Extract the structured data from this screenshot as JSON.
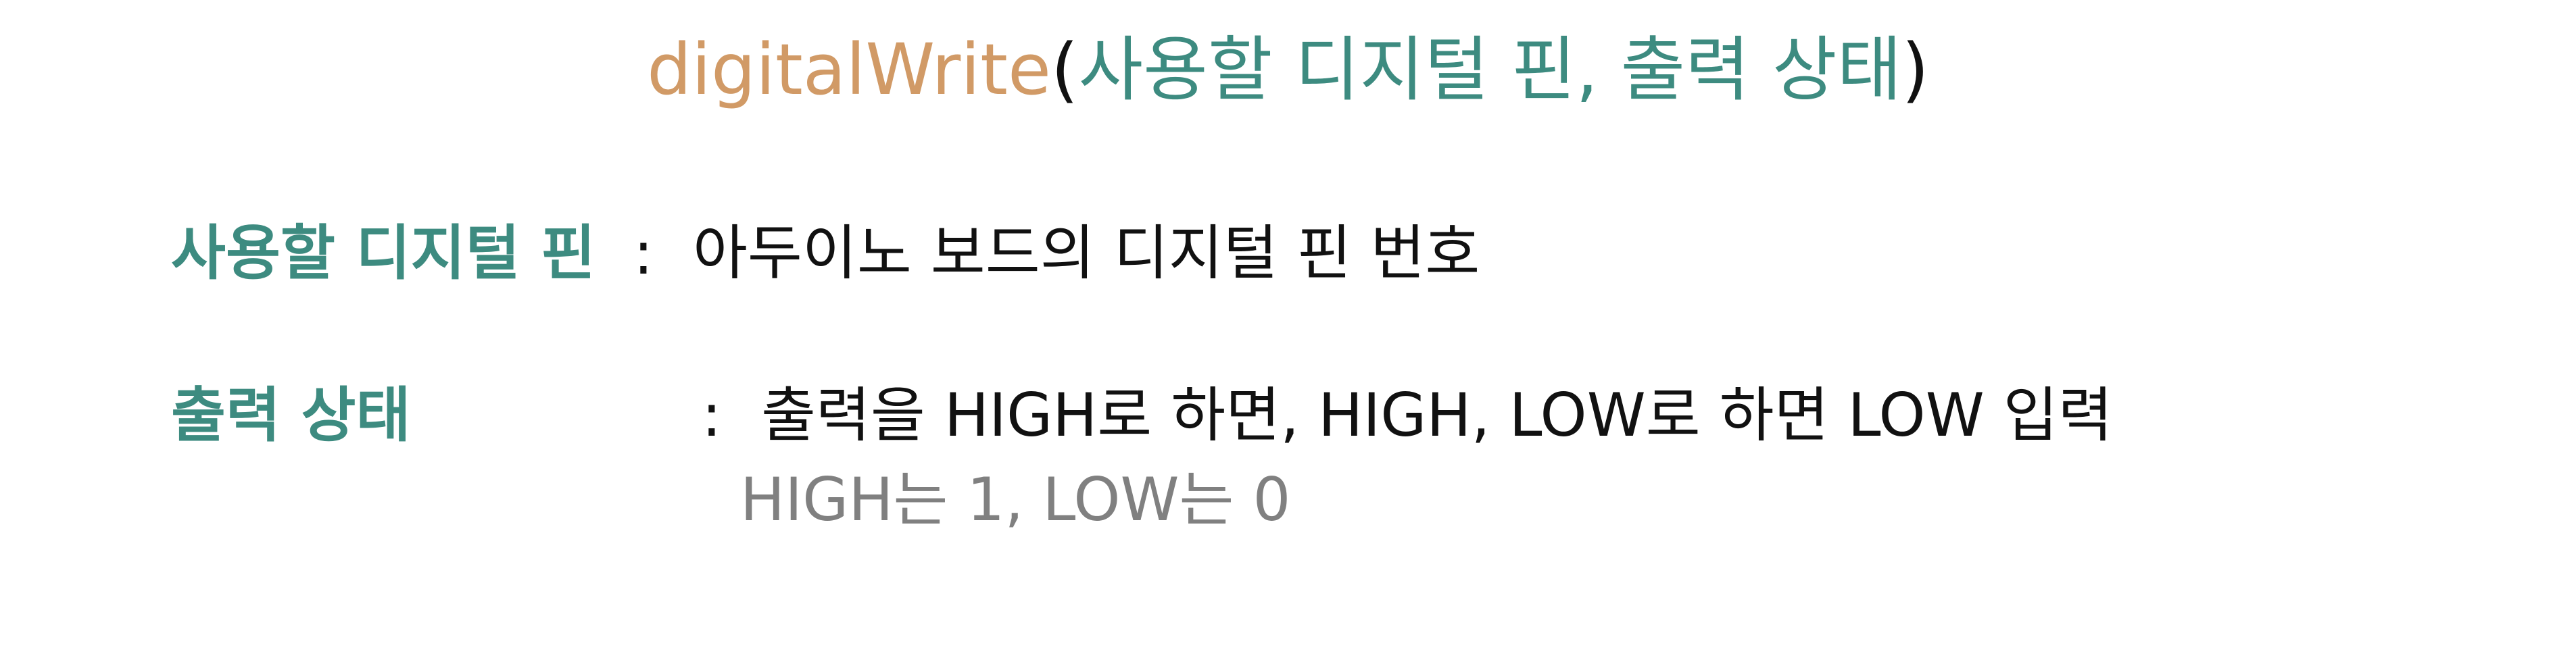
{
  "title": {
    "function_name": "digitalWrite",
    "open_paren": "(",
    "arguments": "사용할 디지털 핀, 출력 상태",
    "close_paren": ")"
  },
  "params": [
    {
      "label": "사용할 디지털 핀",
      "separator": ":",
      "description": "아두이노 보드의 디지털 핀 번호"
    },
    {
      "label": "출력 상태",
      "separator": ":",
      "description": "출력을 HIGH로 하면, HIGH, LOW로 하면 LOW 입력",
      "note": "HIGH는 1, LOW는 0"
    }
  ],
  "colors": {
    "function": "#d19a66",
    "argument": "#3d8b80",
    "text": "#111111",
    "note": "#808080"
  }
}
